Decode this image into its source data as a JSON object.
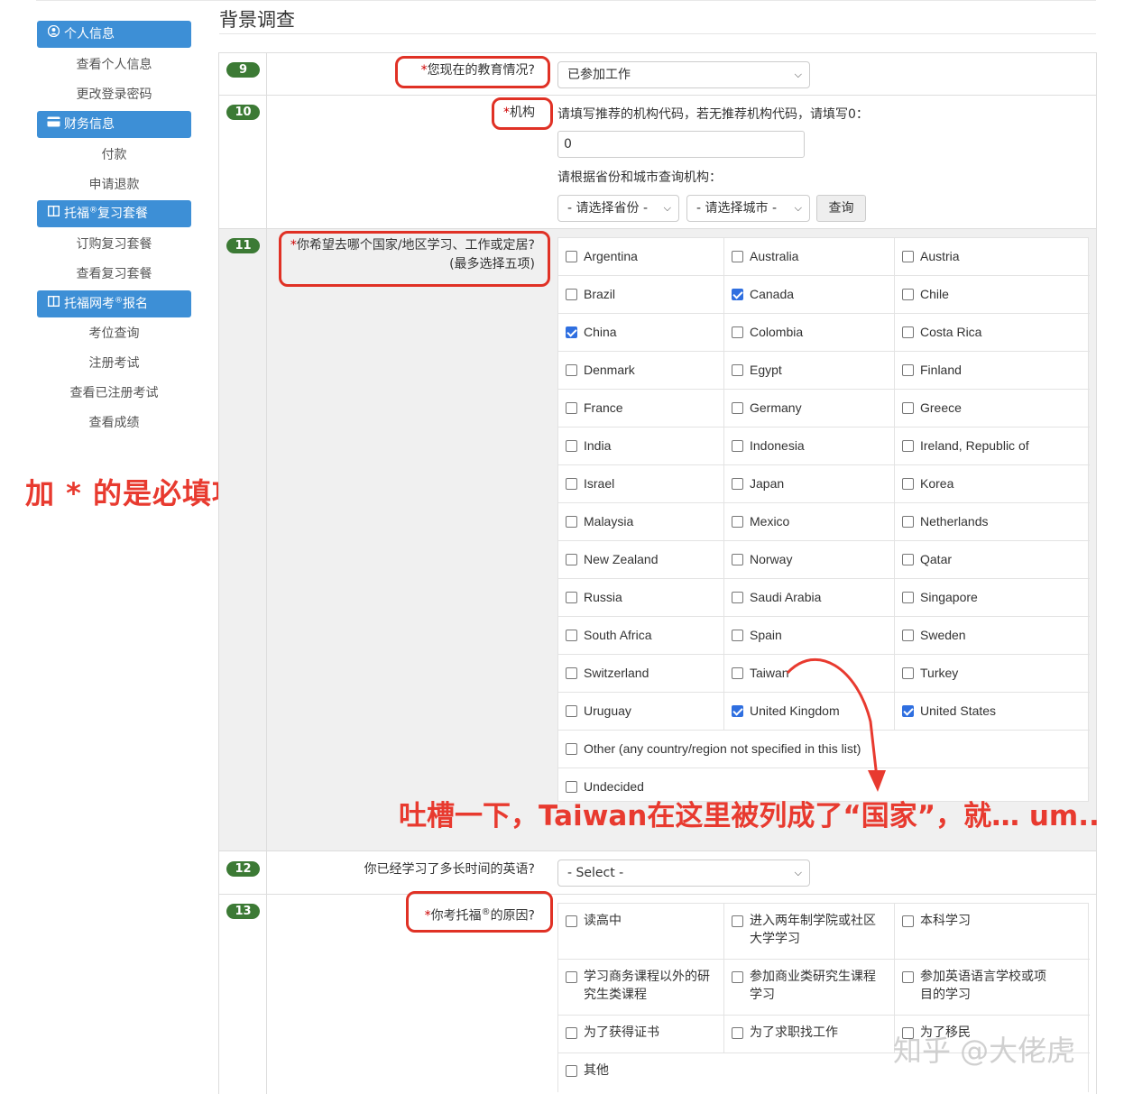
{
  "sidebar": {
    "sections": [
      {
        "label": "个人信息",
        "icon": "user-icon",
        "items": [
          "查看个人信息",
          "更改登录密码"
        ]
      },
      {
        "label": "财务信息",
        "icon": "credit-card-icon",
        "items": [
          "付款",
          "申请退款"
        ]
      },
      {
        "label_pre": "托福",
        "label_sup": "®",
        "label_post": "复习套餐",
        "icon": "book-icon",
        "items": [
          "订购复习套餐",
          "查看复习套餐"
        ]
      },
      {
        "label_pre": "托福网考",
        "label_sup": "®",
        "label_post": "报名",
        "icon": "book-icon",
        "items": [
          "考位查询",
          "注册考试",
          "查看已注册考试",
          "查看成绩"
        ]
      }
    ]
  },
  "annotations": {
    "required_note": "加 * 的是必填项",
    "taiwan_note": "吐槽一下，Taiwan在这里被列成了“国家”，就… um..",
    "watermark": "知乎 @大佬虎"
  },
  "page": {
    "title": "背景调查"
  },
  "q9": {
    "number": "9",
    "label": "您现在的教育情况?",
    "value": "已参加工作"
  },
  "q10": {
    "number": "10",
    "label": "机构",
    "instruction": "请填写推荐的机构代码，若无推荐机构代码，请填写0：",
    "code_value": "0",
    "lookup_label": "请根据省份和城市查询机构：",
    "province_value": "- 请选择省份 -",
    "city_value": "- 请选择城市 -",
    "query_button": "查询"
  },
  "q11": {
    "number": "11",
    "label_line1": "你希望去哪个国家/地区学习、工作或定居?",
    "label_line2": "(最多选择五项)",
    "countries": [
      {
        "name": "Argentina",
        "checked": false
      },
      {
        "name": "Australia",
        "checked": false
      },
      {
        "name": "Austria",
        "checked": false
      },
      {
        "name": "Brazil",
        "checked": false
      },
      {
        "name": "Canada",
        "checked": true
      },
      {
        "name": "Chile",
        "checked": false
      },
      {
        "name": "China",
        "checked": true
      },
      {
        "name": "Colombia",
        "checked": false
      },
      {
        "name": "Costa Rica",
        "checked": false
      },
      {
        "name": "Denmark",
        "checked": false
      },
      {
        "name": "Egypt",
        "checked": false
      },
      {
        "name": "Finland",
        "checked": false
      },
      {
        "name": "France",
        "checked": false
      },
      {
        "name": "Germany",
        "checked": false
      },
      {
        "name": "Greece",
        "checked": false
      },
      {
        "name": "India",
        "checked": false
      },
      {
        "name": "Indonesia",
        "checked": false
      },
      {
        "name": "Ireland, Republic of",
        "checked": false
      },
      {
        "name": "Israel",
        "checked": false
      },
      {
        "name": "Japan",
        "checked": false
      },
      {
        "name": "Korea",
        "checked": false
      },
      {
        "name": "Malaysia",
        "checked": false
      },
      {
        "name": "Mexico",
        "checked": false
      },
      {
        "name": "Netherlands",
        "checked": false
      },
      {
        "name": "New Zealand",
        "checked": false
      },
      {
        "name": "Norway",
        "checked": false
      },
      {
        "name": "Qatar",
        "checked": false
      },
      {
        "name": "Russia",
        "checked": false
      },
      {
        "name": "Saudi Arabia",
        "checked": false
      },
      {
        "name": "Singapore",
        "checked": false
      },
      {
        "name": "South Africa",
        "checked": false
      },
      {
        "name": "Spain",
        "checked": false
      },
      {
        "name": "Sweden",
        "checked": false
      },
      {
        "name": "Switzerland",
        "checked": false
      },
      {
        "name": "Taiwan",
        "checked": false
      },
      {
        "name": "Turkey",
        "checked": false
      },
      {
        "name": "Uruguay",
        "checked": false
      },
      {
        "name": "United Kingdom",
        "checked": true
      },
      {
        "name": "United States",
        "checked": true
      }
    ],
    "other": "Other (any country/region not specified in this list)",
    "undecided": "Undecided"
  },
  "q12": {
    "number": "12",
    "label": "你已经学习了多长时间的英语?",
    "value": "- Select -"
  },
  "q13": {
    "number": "13",
    "label_pre": "你考托福",
    "label_sup": "®",
    "label_post": "的原因?",
    "reasons": [
      "读高中",
      "进入两年制学院或社区大学学习",
      "本科学习",
      "学习商务课程以外的研究生类课程",
      "参加商业类研究生课程学习",
      "参加英语语言学校或项目的学习",
      "为了获得证书",
      "为了求职找工作",
      "为了移民",
      "其他"
    ]
  }
}
